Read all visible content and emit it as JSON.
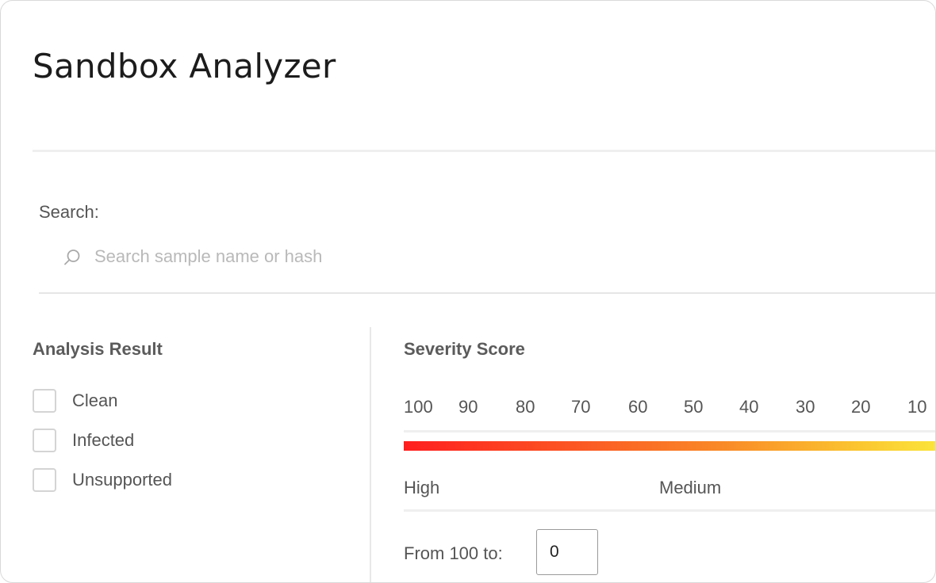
{
  "header": {
    "title": "Sandbox Analyzer"
  },
  "search": {
    "label": "Search:",
    "placeholder": "Search sample name or hash",
    "value": "",
    "icon": "search-icon"
  },
  "analysis_result": {
    "title": "Analysis Result",
    "options": [
      {
        "label": "Clean",
        "checked": false
      },
      {
        "label": "Infected",
        "checked": false
      },
      {
        "label": "Unsupported",
        "checked": false
      }
    ]
  },
  "severity": {
    "title": "Severity Score",
    "ticks": [
      "100",
      "90",
      "80",
      "70",
      "60",
      "50",
      "40",
      "30",
      "20",
      "10"
    ],
    "levels": [
      "High",
      "Medium"
    ],
    "gradient_colors": [
      "#ff1f1f",
      "#f98a27",
      "#fbe43a"
    ],
    "range_label": "From 100 to:",
    "range_value": "0"
  }
}
